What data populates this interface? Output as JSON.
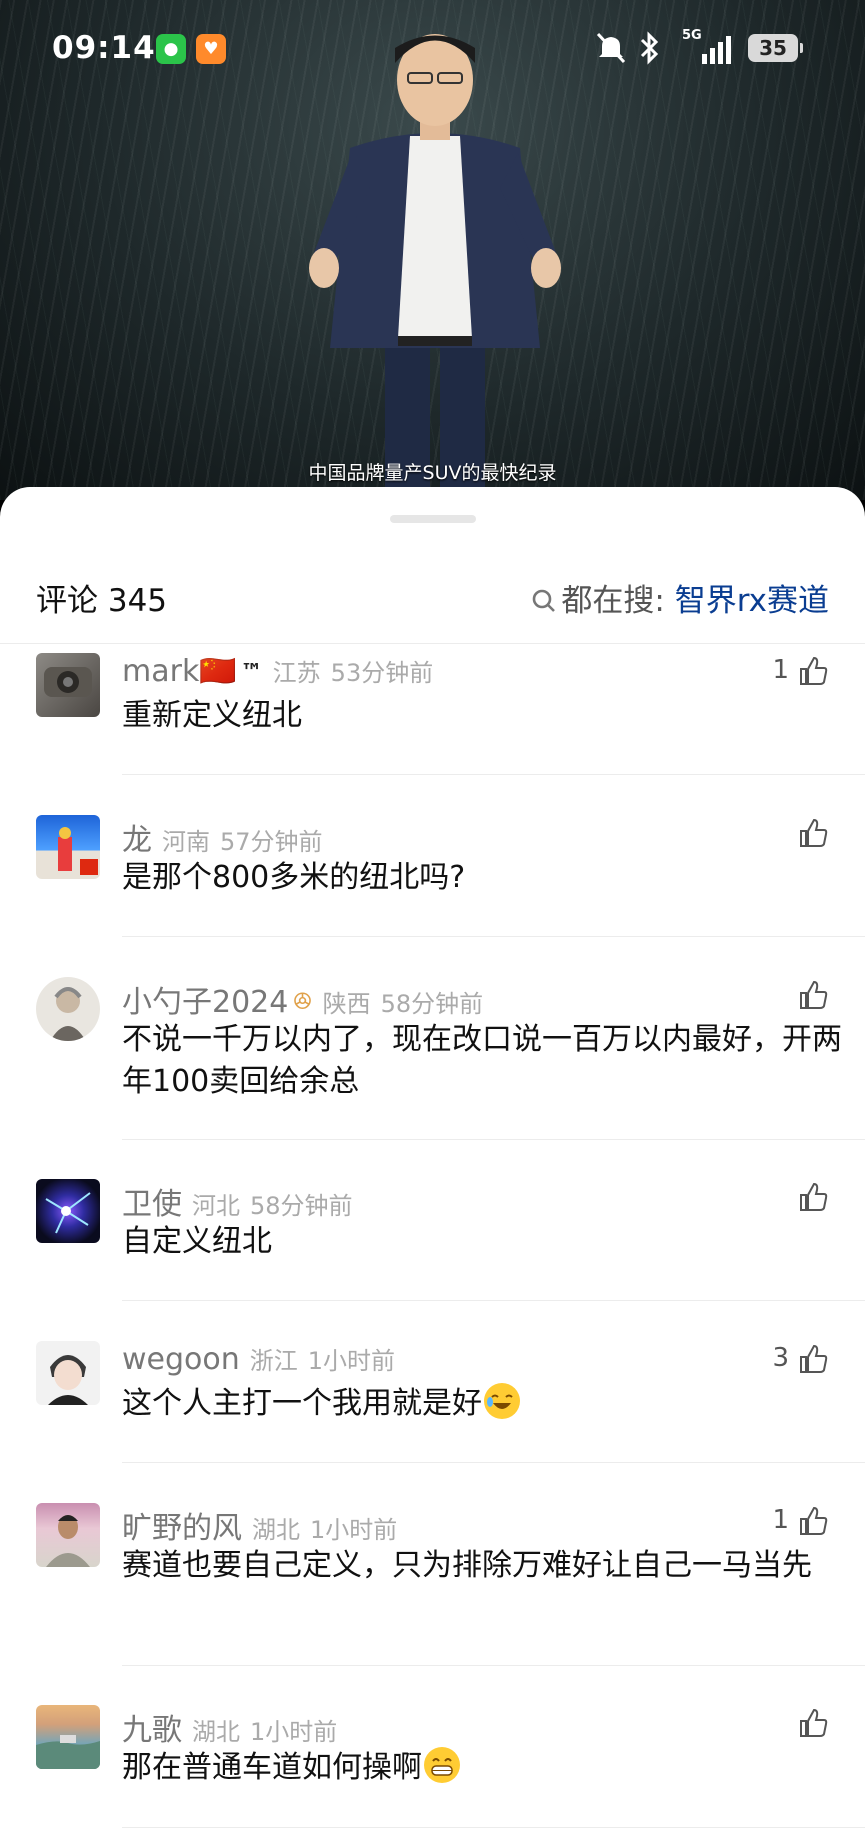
{
  "status_bar": {
    "time": "09:14",
    "network": "5G",
    "battery": "35",
    "icons": [
      "wechat-icon",
      "app-icon",
      "mute-icon",
      "bluetooth-icon",
      "signal-icon",
      "battery-icon"
    ]
  },
  "video": {
    "subtitle": "中国品牌量产SUV的最快纪录"
  },
  "comments_panel": {
    "title": "评论 345",
    "search_prefix": "都在搜:",
    "search_query": "智界rx赛道"
  },
  "comments": [
    {
      "user": "mark🇨🇳",
      "badge": "™",
      "location": "江苏",
      "time": "53分钟前",
      "likes": "1",
      "text": "重新定义纽北"
    },
    {
      "user": "龙",
      "badge": "",
      "location": "河南",
      "time": "57分钟前",
      "likes": "",
      "text": "是那个800多米的纽北吗?"
    },
    {
      "user": "小勺子2024",
      "badge": "ꔮ",
      "location": "陕西",
      "time": "58分钟前",
      "likes": "",
      "text": "不说一千万以内了，现在改口说一百万以内最好，开两年100卖回给余总"
    },
    {
      "user": "卫使",
      "badge": "",
      "location": "河北",
      "time": "58分钟前",
      "likes": "",
      "text": "自定义纽北"
    },
    {
      "user": "wegoon",
      "badge": "",
      "location": "浙江",
      "time": "1小时前",
      "likes": "3",
      "text": "这个人主打一个我用就是好"
    },
    {
      "user": "旷野的风",
      "badge": "",
      "location": "湖北",
      "time": "1小时前",
      "likes": "1",
      "text": "赛道也要自己定义，只为排除万难好让自己一马当先"
    },
    {
      "user": "九歌",
      "badge": "",
      "location": "湖北",
      "time": "1小时前",
      "likes": "",
      "text": "那在普通车道如何操啊"
    }
  ],
  "colors": {
    "sheet_bg": "#ffffff",
    "query_link": "#0a3d91",
    "meta_gray": "#aaaaaa"
  }
}
